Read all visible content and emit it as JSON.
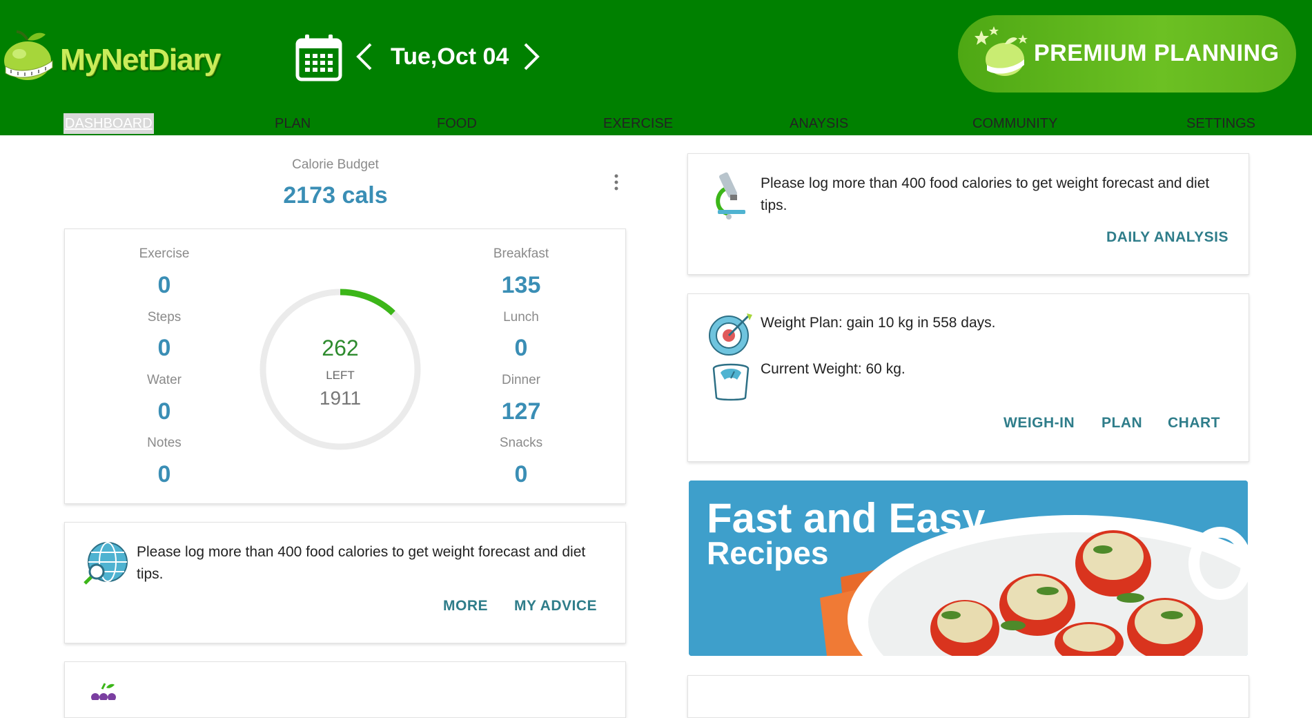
{
  "app": {
    "name": "MyNetDiary"
  },
  "header": {
    "date": "Tue,Oct 04",
    "premium_label": "PREMIUM PLANNING"
  },
  "nav": {
    "items": [
      "DASHBOARD",
      "PLAN",
      "FOOD",
      "EXERCISE",
      "ANAYSIS",
      "COMMUNITY",
      "SETTINGS"
    ],
    "active": "DASHBOARD"
  },
  "calorie_budget": {
    "title": "Calorie Budget",
    "value": "2173 cals"
  },
  "summary": {
    "left": [
      {
        "label": "Exercise",
        "value": "0"
      },
      {
        "label": "Steps",
        "value": "0"
      },
      {
        "label": "Water",
        "value": "0"
      },
      {
        "label": "Notes",
        "value": "0"
      }
    ],
    "right": [
      {
        "label": "Breakfast",
        "value": "135"
      },
      {
        "label": "Lunch",
        "value": "0"
      },
      {
        "label": "Dinner",
        "value": "127"
      },
      {
        "label": "Snacks",
        "value": "0"
      }
    ],
    "ring": {
      "eaten": "262",
      "left_label": "LEFT",
      "remaining": "1911",
      "progress_fraction": 0.12
    }
  },
  "advice_card": {
    "message": "Please log more than 400 food calories to get weight forecast and diet tips.",
    "more_label": "MORE",
    "my_advice_label": "MY ADVICE"
  },
  "analysis_card": {
    "message": "Please log more than 400 food calories to get weight forecast and diet tips.",
    "daily_analysis_label": "DAILY ANALYSIS"
  },
  "weight_card": {
    "plan": "Weight Plan: gain 10 kg in 558 days.",
    "current": "Current Weight: 60 kg.",
    "weigh_in_label": "WEIGH-IN",
    "plan_label": "PLAN",
    "chart_label": "CHART"
  },
  "recipe_banner": {
    "title": "Fast and Easy",
    "subtitle": "Recipes"
  },
  "colors": {
    "header_bg": "#008000",
    "accent_blue": "#3a8eb5",
    "link_teal": "#2f7d8a",
    "ring_progress": "#3cb619"
  }
}
